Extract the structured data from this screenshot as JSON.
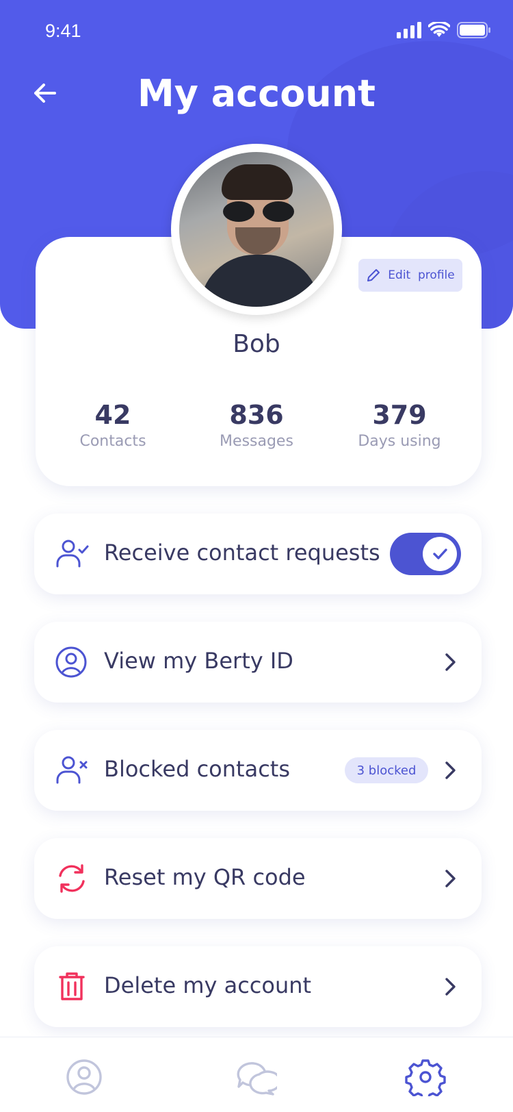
{
  "status_bar": {
    "time": "9:41"
  },
  "header": {
    "title": "My account"
  },
  "profile": {
    "name": "Bob",
    "edit_label": "Edit  profile",
    "stats": [
      {
        "value": "42",
        "label": "Contacts"
      },
      {
        "value": "836",
        "label": "Messages"
      },
      {
        "value": "379",
        "label": "Days using"
      }
    ]
  },
  "settings": {
    "contact_requests": {
      "label": "Receive contact requests",
      "enabled": true
    },
    "berty_id": {
      "label": "View my Berty ID"
    },
    "blocked": {
      "label": "Blocked contacts",
      "badge": "3 blocked"
    },
    "reset_qr": {
      "label": "Reset my QR code"
    },
    "delete": {
      "label": "Delete my account"
    }
  },
  "bottom_nav": {
    "items": [
      "contacts-icon",
      "chat-icon",
      "settings-icon"
    ],
    "active": "settings-icon"
  },
  "colors": {
    "accent": "#525bea",
    "accent_dark": "#4c54d2",
    "text": "#393a63",
    "muted": "#9a9bb4",
    "danger": "#f1315c",
    "badge_bg": "#e3e5fb",
    "inactive_icon": "#c1c5dc"
  }
}
